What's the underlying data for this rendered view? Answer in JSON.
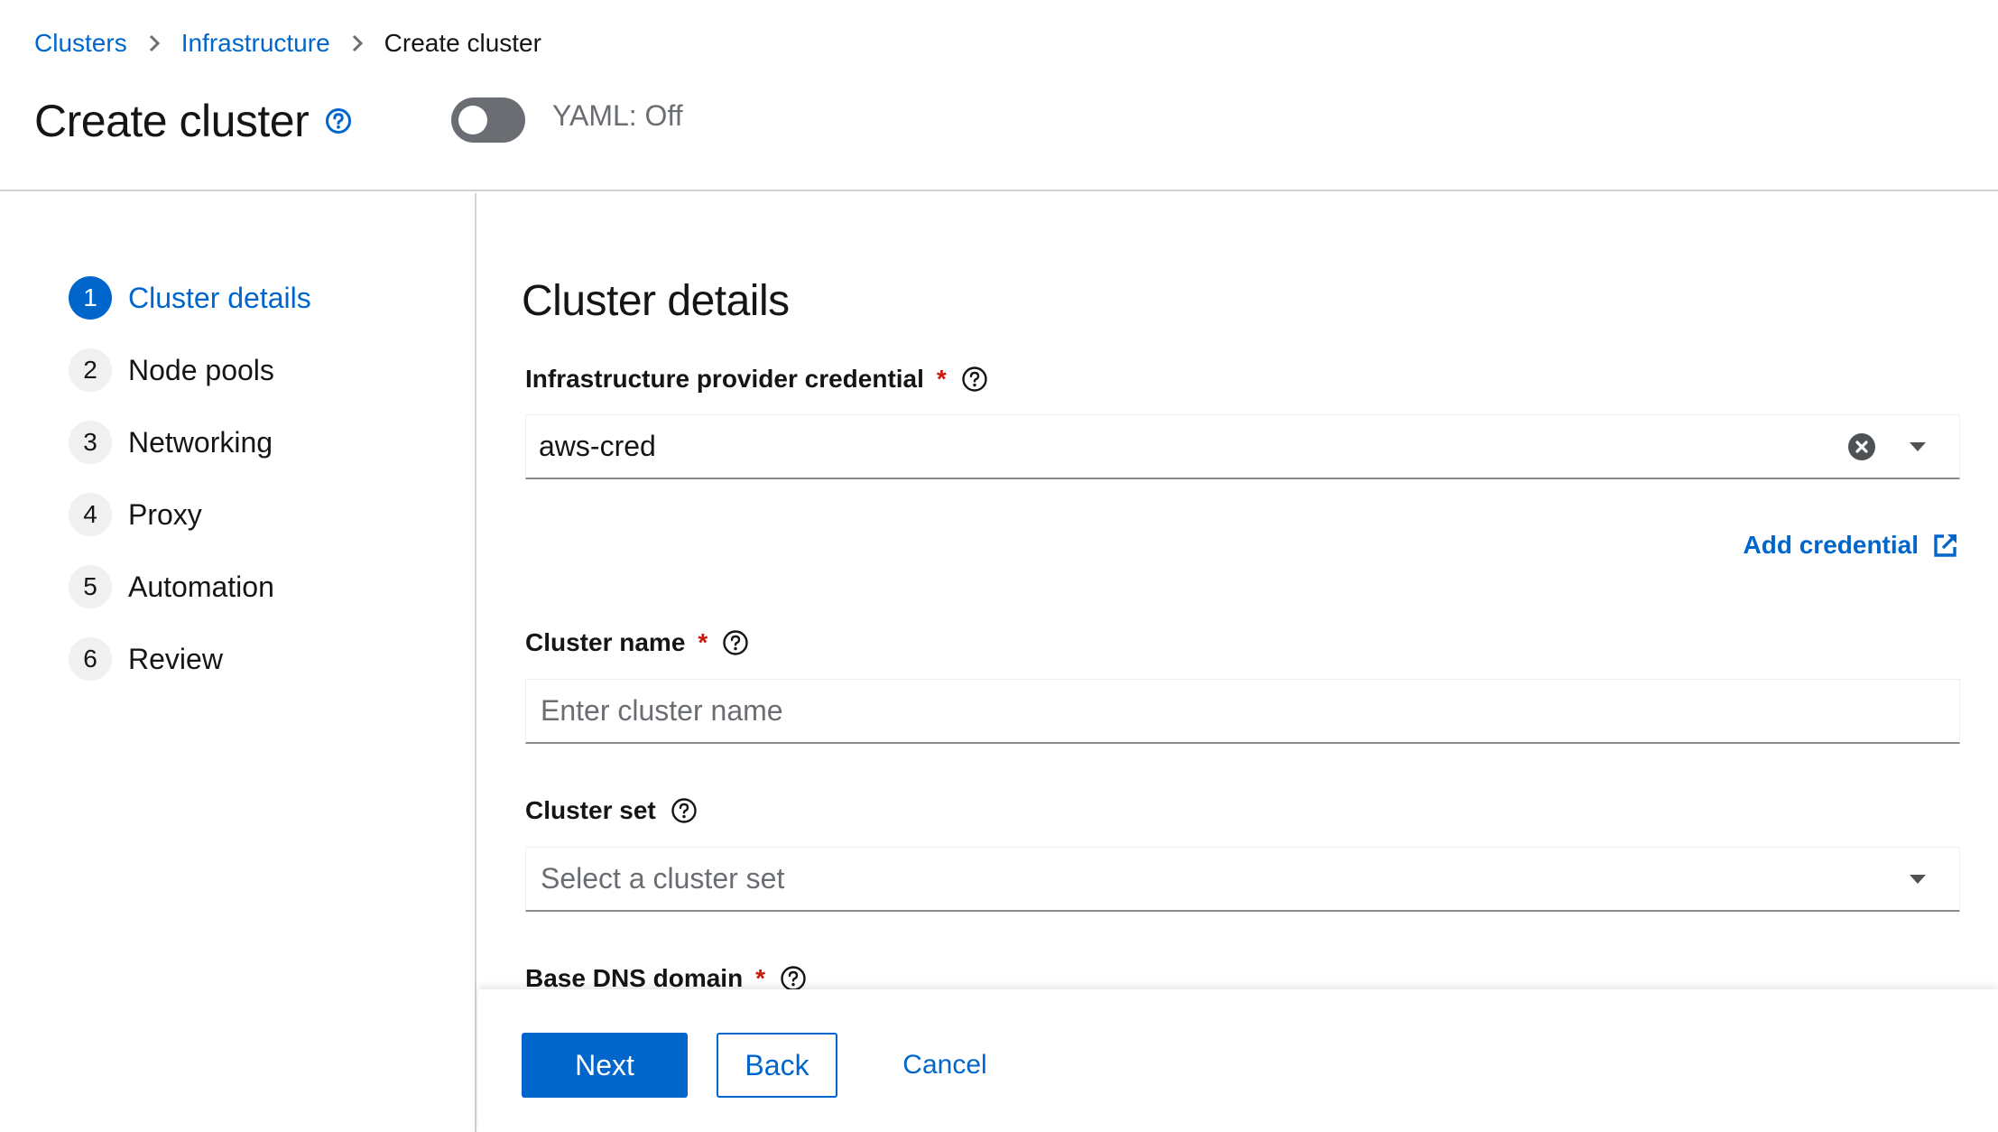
{
  "breadcrumb": {
    "items": [
      {
        "label": "Clusters"
      },
      {
        "label": "Infrastructure"
      }
    ],
    "current": "Create cluster"
  },
  "header": {
    "title": "Create cluster",
    "yaml_toggle": {
      "label": "YAML: Off",
      "on": false
    }
  },
  "colors": {
    "accent": "#0066cc",
    "required": "#c9190b",
    "toggle_off": "#6a6e73"
  },
  "wizard": {
    "steps": [
      {
        "number": "1",
        "label": "Cluster details",
        "current": true
      },
      {
        "number": "2",
        "label": "Node pools"
      },
      {
        "number": "3",
        "label": "Networking"
      },
      {
        "number": "4",
        "label": "Proxy"
      },
      {
        "number": "5",
        "label": "Automation"
      },
      {
        "number": "6",
        "label": "Review"
      }
    ],
    "section_title": "Cluster details",
    "fields": {
      "credential": {
        "label": "Infrastructure provider credential",
        "required_marker": "*",
        "value": "aws-cred"
      },
      "add_credential": {
        "label": "Add credential"
      },
      "cluster_name": {
        "label": "Cluster name",
        "required_marker": "*",
        "placeholder": "Enter cluster name"
      },
      "cluster_set": {
        "label": "Cluster set",
        "placeholder": "Select a cluster set"
      },
      "base_dns": {
        "label": "Base DNS domain",
        "required_marker": "*"
      }
    },
    "footer": {
      "next": "Next",
      "back": "Back",
      "cancel": "Cancel"
    }
  }
}
